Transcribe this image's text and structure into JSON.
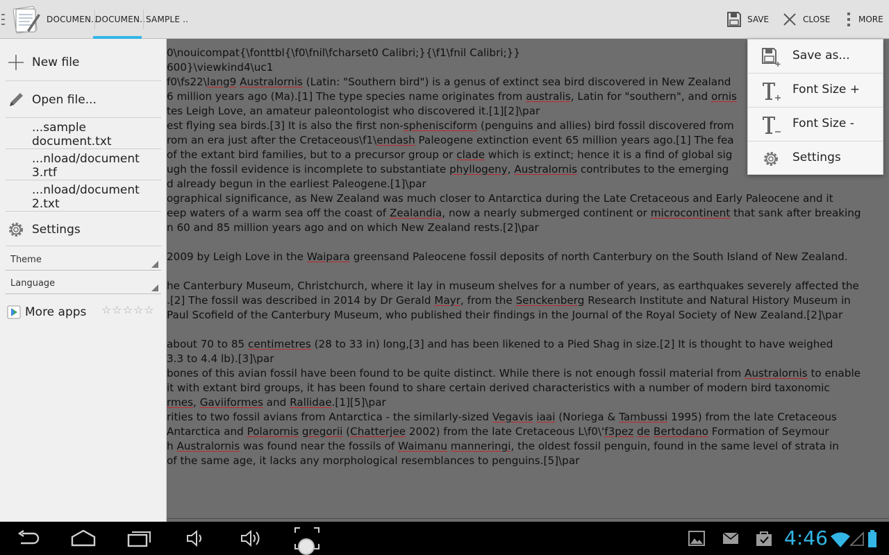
{
  "app": {
    "icon": "notepad-app-icon"
  },
  "tabs": [
    {
      "label": "DOCUMEN..",
      "active": false
    },
    {
      "label": "DOCUMEN..",
      "active": true
    },
    {
      "label": "SAMPLE ..",
      "active": false
    }
  ],
  "actions": {
    "save_label": "SAVE",
    "close_label": "CLOSE",
    "more_label": "MORE"
  },
  "colors": {
    "accent": "#33b5e5",
    "spellcheck_underline": "#c0282d",
    "dimmed_editor": "#6e6e6e",
    "drawer_bg": "#f0f0f0"
  },
  "drawer": {
    "new_file": "New file",
    "open_file": "Open file...",
    "recent_files": [
      "...sample document.txt",
      "...nload/document 3.rtf",
      "...nload/document 2.txt"
    ],
    "settings": "Settings",
    "theme_label": "Theme",
    "language_label": "Language",
    "more_apps": "More apps",
    "rating_stars": "☆☆☆☆☆"
  },
  "overflow_menu": {
    "save_as": "Save as...",
    "font_size_plus": "Font Size +",
    "font_size_minus": "Font Size -",
    "settings": "Settings"
  },
  "editor": {
    "lines": [
      [
        {
          "t": "0\\nouicompat{\\fonttbl{\\f0\\fnil\\fcharset0 Calibri;}{\\f1\\fnil Calibri;}}"
        }
      ],
      [
        {
          "t": "600}\\viewkind4\\uc1"
        }
      ],
      [
        {
          "t": "f0\\fs22\\"
        },
        {
          "t": "lang9",
          "u": true
        },
        {
          "t": " "
        },
        {
          "t": "Australornis",
          "u": true
        },
        {
          "t": " (Latin: \"Southern bird\") is a genus of extinct sea bird discovered in New Zealand"
        }
      ],
      [
        {
          "t": "6 million years ago (Ma).[1] The type species name originates from "
        },
        {
          "t": "australis",
          "u": true
        },
        {
          "t": ", Latin for \"southern\", and "
        },
        {
          "t": "ornis",
          "u": true
        }
      ],
      [
        {
          "t": "tes Leigh Love, an amateur paleontologist who discovered it.[1][2]\\par"
        }
      ],
      [
        {
          "t": "est flying sea birds.[3] It is also the first non-"
        },
        {
          "t": "sphenisciform",
          "u": true
        },
        {
          "t": " (penguins and allies) bird fossil discovered from"
        }
      ],
      [
        {
          "t": "rom an era just after the Cretaceous\\f1\\"
        },
        {
          "t": "endash",
          "u": true
        },
        {
          "t": " Paleogene extinction event 65 million years ago.[1] The fea"
        }
      ],
      [
        {
          "t": " of the extant bird families, but to a precursor group or "
        },
        {
          "t": "clade",
          "u": true
        },
        {
          "t": " which is extinct; hence it is a find of global sig"
        }
      ],
      [
        {
          "t": "ugh the fossil evidence is incomplete to substantiate "
        },
        {
          "t": "phyllogeny",
          "u": true
        },
        {
          "t": ", "
        },
        {
          "t": "Australornis",
          "u": true
        },
        {
          "t": " contributes to the emerging"
        }
      ],
      [
        {
          "t": "d already begun in the earliest Paleogene.[1]\\par"
        }
      ],
      [
        {
          "t": "ographical significance, as New Zealand was much closer to Antarctica during the Late Cretaceous and Early Paleocene and it"
        }
      ],
      [
        {
          "t": "eep waters of a warm sea off the coast of "
        },
        {
          "t": "Zealandia",
          "u": true
        },
        {
          "t": ", now a nearly submerged continent or "
        },
        {
          "t": "microcontinent",
          "u": true
        },
        {
          "t": " that sank after breaking"
        }
      ],
      [
        {
          "t": "n 60 and 85 million years ago and on which New Zealand rests.[2]\\par"
        }
      ],
      [
        {
          "t": ""
        }
      ],
      [
        {
          "t": "2009 by Leigh Love in the "
        },
        {
          "t": "Waipara",
          "u": true
        },
        {
          "t": " greensand Paleocene fossil deposits of north Canterbury on the South Island of New Zealand."
        }
      ],
      [
        {
          "t": ""
        }
      ],
      [
        {
          "t": "he Canterbury Museum, Christchurch, where it lay in museum shelves for a number of years, as earthquakes severely affected the"
        }
      ],
      [
        {
          "t": ".[2] The fossil was described in 2014 by Dr Gerald "
        },
        {
          "t": "Mayr",
          "u": true
        },
        {
          "t": ", from the "
        },
        {
          "t": "Senckenberg",
          "u": true
        },
        {
          "t": " Research Institute and Natural History Museum in"
        }
      ],
      [
        {
          "t": "Paul Scofield of the Canterbury Museum, who published their findings in the Journal of the Royal Society of New Zealand.[2]\\par"
        }
      ],
      [
        {
          "t": ""
        }
      ],
      [
        {
          "t": "about 70 to 85 "
        },
        {
          "t": "centimetres",
          "u": true
        },
        {
          "t": " (28 to 33 in) long,[3] and has been likened to a Pied Shag in size.[2] It is thought to have weighed"
        }
      ],
      [
        {
          "t": "3.3 to 4.4 lb).[3]\\par"
        }
      ],
      [
        {
          "t": " bones of this avian fossil have been found to be quite distinct. While there is not enough fossil material from "
        },
        {
          "t": "Australornis",
          "u": true
        },
        {
          "t": " to enable"
        }
      ],
      [
        {
          "t": "it with extant bird groups, it has been found to share certain derived characteristics with a number of modern bird taxonomic"
        }
      ],
      [
        {
          "t": "rmes",
          "u": true
        },
        {
          "t": ", "
        },
        {
          "t": "Gaviiformes",
          "u": true
        },
        {
          "t": " and "
        },
        {
          "t": "Rallidae",
          "u": true
        },
        {
          "t": ".[1][5]\\par"
        }
      ],
      [
        {
          "t": "rities to two fossil avians from Antarctica - the similarly-sized "
        },
        {
          "t": "Vegavis",
          "u": true
        },
        {
          "t": " "
        },
        {
          "t": "iaai",
          "u": true
        },
        {
          "t": " (Noriega & "
        },
        {
          "t": "Tambussi",
          "u": true
        },
        {
          "t": " 1995) from the late Cretaceous"
        }
      ],
      [
        {
          "t": " Antarctica and "
        },
        {
          "t": "Polarornis",
          "u": true
        },
        {
          "t": " "
        },
        {
          "t": "gregorii",
          "u": true
        },
        {
          "t": " ("
        },
        {
          "t": "Chatterjee",
          "u": true
        },
        {
          "t": " 2002) from the late Cretaceous L\\f0\\'"
        },
        {
          "t": "f3pez",
          "u": true
        },
        {
          "t": " "
        },
        {
          "t": "de",
          "u": true
        },
        {
          "t": " "
        },
        {
          "t": "Bertodano",
          "u": true
        },
        {
          "t": " Formation of Seymour"
        }
      ],
      [
        {
          "t": "h "
        },
        {
          "t": "Australornis",
          "u": true
        },
        {
          "t": " was found near the fossils of "
        },
        {
          "t": "Waimanu",
          "u": true
        },
        {
          "t": " "
        },
        {
          "t": "manneringi",
          "u": true
        },
        {
          "t": ", the oldest fossil penguin, found in the same level of strata in"
        }
      ],
      [
        {
          "t": "of the same age, it lacks any morphological resemblances to penguins.[5]\\par"
        }
      ]
    ]
  },
  "status": {
    "time": "4:46"
  }
}
